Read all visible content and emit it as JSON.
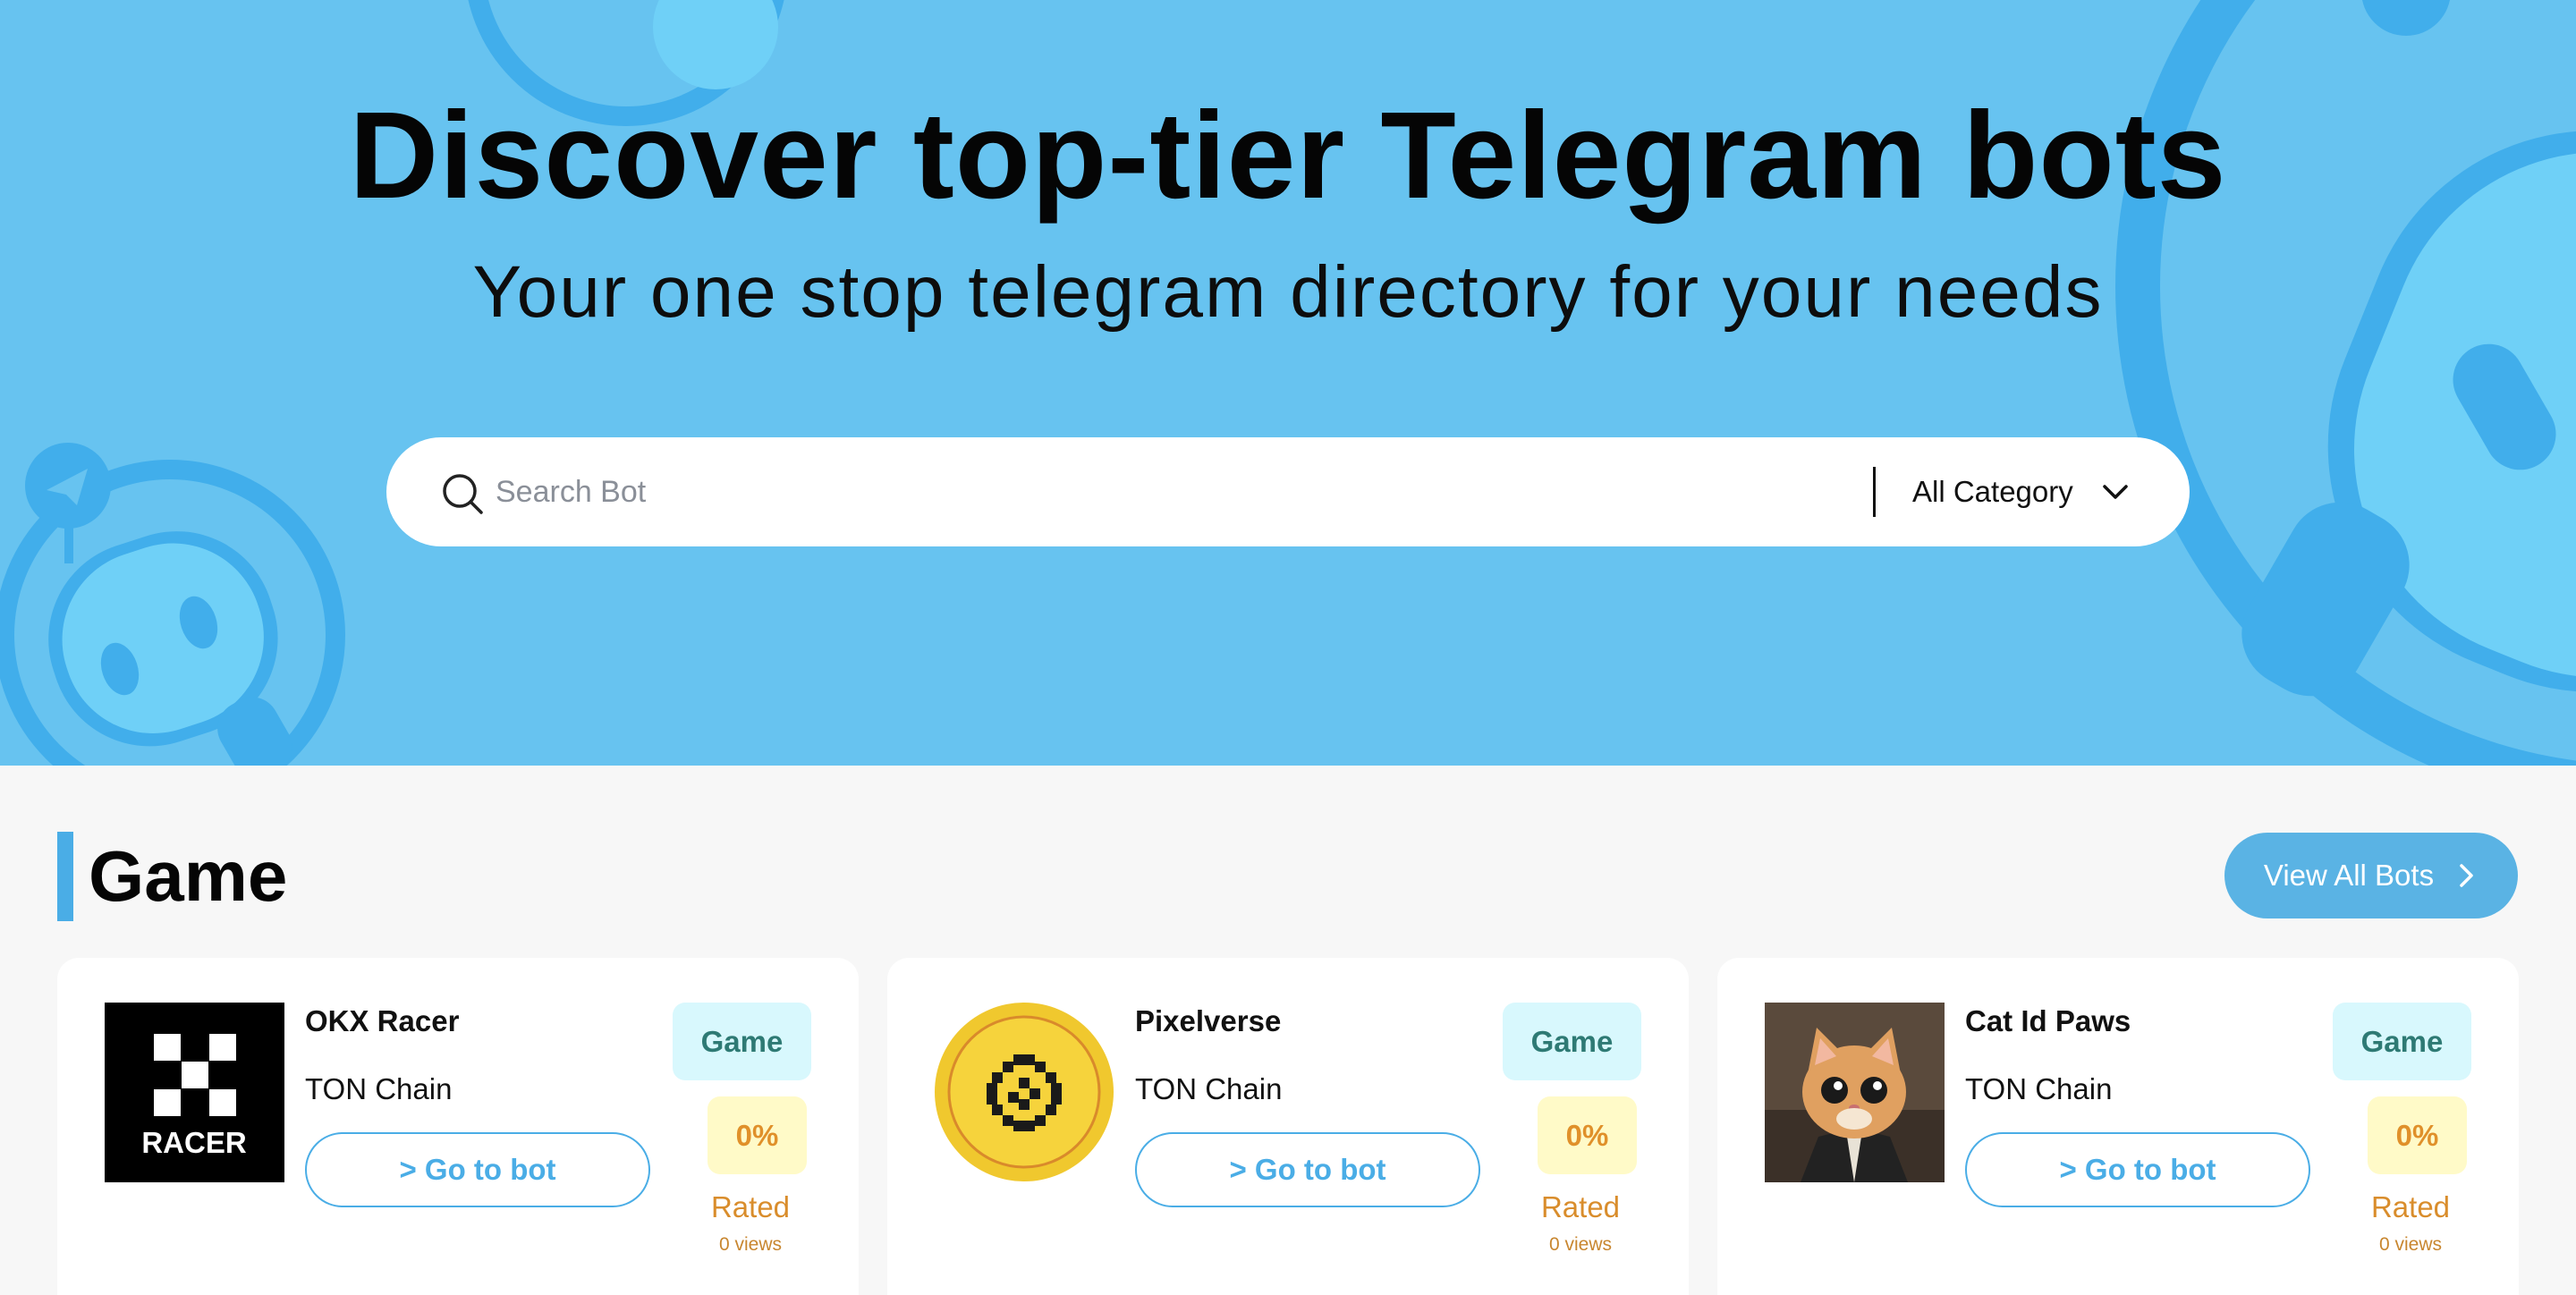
{
  "hero": {
    "title": "Discover top-tier Telegram bots",
    "subtitle": "Your one stop telegram directory for your needs"
  },
  "search": {
    "placeholder": "Search Bot",
    "value": "",
    "category_label": "All Category",
    "search_icon": "search-icon",
    "dropdown_icon": "chevron-down-icon"
  },
  "section": {
    "title": "Game",
    "view_all_label": "View All Bots",
    "accent_color": "#4aade6"
  },
  "cards": [
    {
      "name": "OKX Racer",
      "chain": "TON Chain",
      "go_label": "> Go to bot",
      "category": "Game",
      "rating_pct": "0%",
      "rated_label": "Rated",
      "views": "0 views",
      "logo_text": "RACER"
    },
    {
      "name": "Pixelverse",
      "chain": "TON Chain",
      "go_label": "> Go to bot",
      "category": "Game",
      "rating_pct": "0%",
      "rated_label": "Rated",
      "views": "0 views"
    },
    {
      "name": "Cat Id Paws",
      "chain": "TON Chain",
      "go_label": "> Go to bot",
      "category": "Game",
      "rating_pct": "0%",
      "rated_label": "Rated",
      "views": "0 views"
    }
  ],
  "colors": {
    "hero_bg": "#67c3f0",
    "category_badge_bg": "#d8f8fd",
    "rating_badge_bg": "#fffac8",
    "rating_text": "#e0902a"
  }
}
